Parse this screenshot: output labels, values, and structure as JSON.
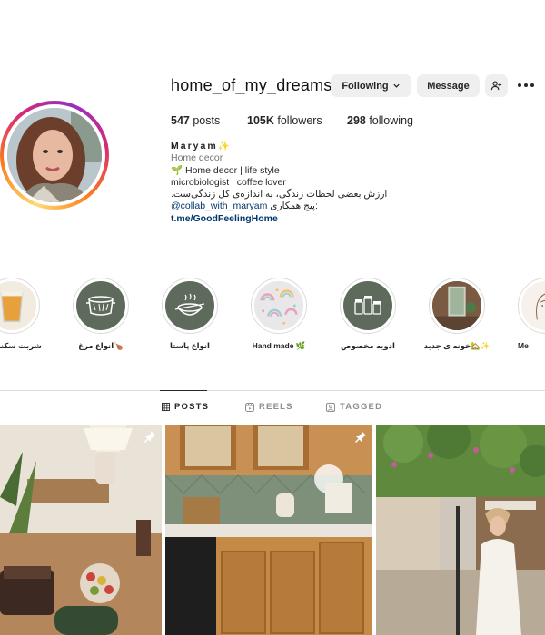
{
  "profile": {
    "username": "home_of_my_dreams__",
    "following_button": "Following",
    "message_button": "Message",
    "stats": {
      "posts_count": "547",
      "posts_label": " posts",
      "followers_count": "105K",
      "followers_label": " followers",
      "following_count": "298",
      "following_label": " following"
    },
    "bio": {
      "name": "Maryam✨",
      "category": "Home decor",
      "line1": "🌱 Home decor | life style",
      "line2": "microbiologist | coffee lover",
      "line3": "ارزش بعضی لحظات زندگی، به اندازه‌ی کل زندگی‌ست.",
      "line4_prefix": "پیج همکاری: ",
      "line4_mention": "@collab_with_maryam",
      "link": "t.me/GoodFeelingHome"
    }
  },
  "highlights": [
    {
      "label": "شربت سکنجبین",
      "icon": "drink-glass"
    },
    {
      "label": "انواع مرغ🍗",
      "icon": "pot-icon"
    },
    {
      "label": "انواع پاستا",
      "icon": "pasta-bowl-icon"
    },
    {
      "label": "Hand made 🌿",
      "icon": "rainbow-pattern"
    },
    {
      "label": "ادویه مخصوص",
      "icon": "spice-jars-icon"
    },
    {
      "label": "خونه ی جدید🏡✨",
      "icon": "room-photo"
    },
    {
      "label": "Me",
      "icon": "sketch-portrait"
    }
  ],
  "tabs": [
    {
      "label": "POSTS",
      "icon": "grid-icon",
      "active": true
    },
    {
      "label": "REELS",
      "icon": "reels-icon",
      "active": false
    },
    {
      "label": "TAGGED",
      "icon": "tagged-icon",
      "active": false
    }
  ],
  "posts": [
    {
      "description": "dining table with cake and lamp",
      "pinned": true
    },
    {
      "description": "wooden kitchen with green tiles",
      "pinned": true
    },
    {
      "description": "woman in white dress under flowering tree",
      "pinned": false
    }
  ],
  "colors": {
    "accent_link": "#00376b",
    "button_bg": "#efefef",
    "highlight_green": "#5e6a5b",
    "divider": "#dbdbdb"
  }
}
